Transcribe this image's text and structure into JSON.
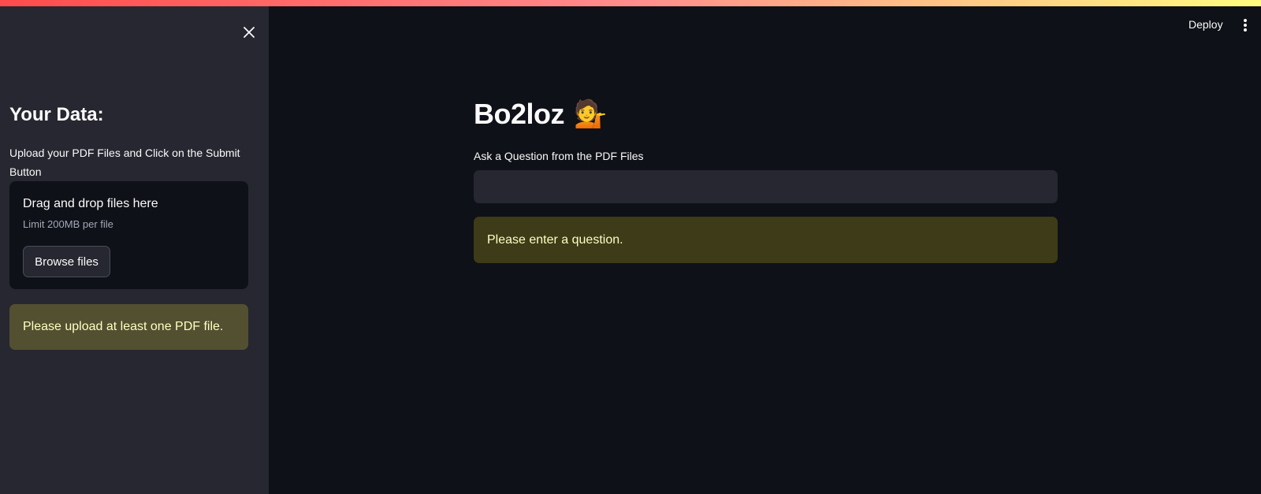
{
  "header": {
    "deploy_label": "Deploy",
    "menu_icon": "more-vertical-icon"
  },
  "sidebar": {
    "close_icon": "close-icon",
    "title": "Your Data:",
    "description": "Upload your PDF Files and Click on the Submit Button",
    "uploader": {
      "drop_text": "Drag and drop files here",
      "limit_text": "Limit 200MB per file",
      "browse_label": "Browse files"
    },
    "warning": "Please upload at least one PDF file."
  },
  "main": {
    "title": "Bo2loz",
    "title_emoji": "💁",
    "question_label": "Ask a Question from the PDF Files",
    "question_value": "",
    "warning": "Please enter a question."
  },
  "colors": {
    "background": "#0e1117",
    "sidebar": "#262730",
    "warning_bg": "#3d3b18",
    "warning_text": "#ffffc2",
    "accent": "#ff4b4b"
  }
}
